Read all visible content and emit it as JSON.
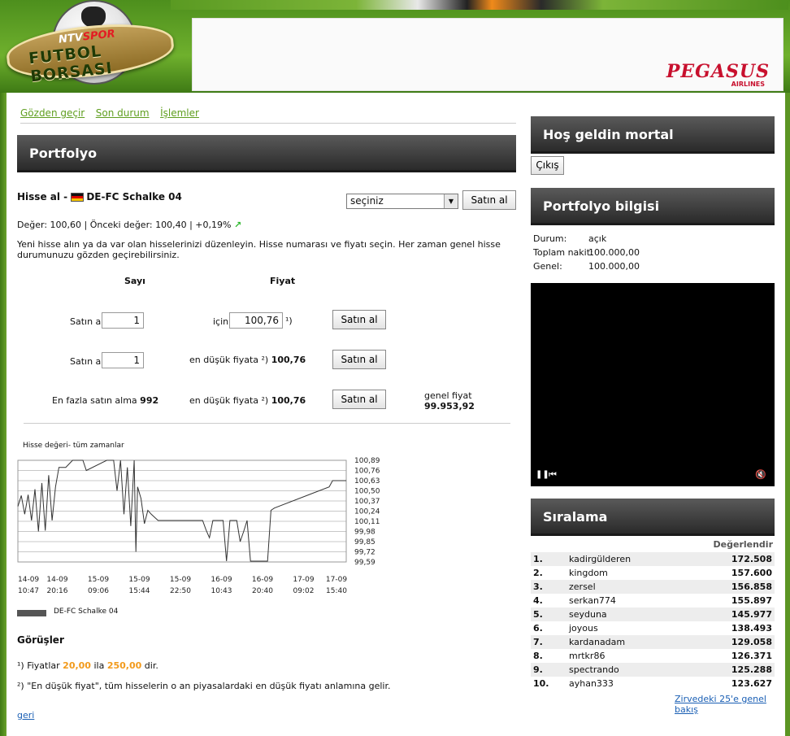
{
  "header": {
    "logo_ntv": "NTV",
    "logo_spor": "SPOR",
    "logo_title": "FUTBOL BORSASI",
    "ad_brand": "PEGASUS",
    "ad_brand_sub": "AIRLINES"
  },
  "tabs": [
    "Gözden geçir",
    "Son durum",
    "İşlemler"
  ],
  "portfolio": {
    "title": "Portfolyo",
    "buy_prefix": "Hisse al -",
    "team": "DE-FC Schalke 04",
    "select_value": "seçiniz",
    "select_button": "Satın al",
    "value_line": "Değer: 100,60 | Önceki değer: 100,40 | +0,19%",
    "trend_icon": "↗",
    "description": "Yeni hisse alın ya da var olan hisselerinizi düzenleyin. Hisse numarası ve fiyatı seçin. Her zaman genel hisse durumunuzu gözden geçirebilirsiniz.",
    "col_count": "Sayı",
    "col_price": "Fiyat",
    "row1": {
      "label": "Satın al",
      "qty": "1",
      "for": "için",
      "price": "100,76",
      "sup": "¹)",
      "button": "Satın al"
    },
    "row2": {
      "label": "Satın al",
      "qty": "1",
      "lowest_label": "en düşük fiyata ²)",
      "lowest_value": "100,76",
      "button": "Satın al"
    },
    "row3": {
      "label": "En fazla satın alma",
      "max": "992",
      "lowest_label": "en düşük fiyata ²)",
      "lowest_value": "100,76",
      "button": "Satın al",
      "total_label": "genel fiyat",
      "total_value": "99.953,92"
    }
  },
  "chart_data": {
    "type": "line",
    "title": "Hisse değeri- tüm zamanlar",
    "x_ticks": [
      "14-09\n10:47",
      "14-09\n20:16",
      "15-09\n09:06",
      "15-09\n15:44",
      "15-09\n22:50",
      "16-09\n10:43",
      "16-09\n20:40",
      "17-09\n09:02",
      "17-09\n15:40"
    ],
    "y_ticks": [
      "100,89",
      "100,76",
      "100,63",
      "100,50",
      "100,37",
      "100,24",
      "100,11",
      "99,98",
      "99,85",
      "99,72",
      "99,59"
    ],
    "ylim": [
      99.59,
      100.89
    ],
    "legend": "DE-FC Schalke 04",
    "series": [
      {
        "name": "DE-FC Schalke 04",
        "points": [
          [
            0,
            100.3
          ],
          [
            1,
            100.44
          ],
          [
            2,
            100.2
          ],
          [
            3,
            100.45
          ],
          [
            4,
            100.12
          ],
          [
            5,
            100.52
          ],
          [
            6,
            99.98
          ],
          [
            7,
            100.6
          ],
          [
            8,
            99.99
          ],
          [
            9,
            100.7
          ],
          [
            10,
            100.12
          ],
          [
            11,
            100.55
          ],
          [
            12,
            100.8
          ],
          [
            14,
            100.8
          ],
          [
            16,
            100.89
          ],
          [
            19,
            100.89
          ],
          [
            20,
            100.76
          ],
          [
            26,
            100.89
          ],
          [
            28,
            100.89
          ],
          [
            29,
            100.5
          ],
          [
            30,
            100.89
          ],
          [
            31,
            100.2
          ],
          [
            32,
            100.8
          ],
          [
            33,
            100.05
          ],
          [
            34,
            100.89
          ],
          [
            34.5,
            99.72
          ],
          [
            35,
            100.55
          ],
          [
            36,
            100.4
          ],
          [
            37,
            100.08
          ],
          [
            38,
            100.25
          ],
          [
            39,
            100.2
          ],
          [
            41,
            100.12
          ],
          [
            54,
            100.12
          ],
          [
            55,
            100.0
          ],
          [
            56,
            99.9
          ],
          [
            57,
            100.12
          ],
          [
            60,
            100.12
          ],
          [
            61,
            99.6
          ],
          [
            62,
            100.12
          ],
          [
            64,
            100.12
          ],
          [
            65,
            99.85
          ],
          [
            66,
            99.98
          ],
          [
            67,
            100.12
          ],
          [
            68,
            99.6
          ],
          [
            73,
            99.6
          ],
          [
            74,
            100.25
          ],
          [
            75,
            100.28
          ],
          [
            91,
            100.55
          ],
          [
            92,
            100.63
          ],
          [
            96,
            100.63
          ]
        ]
      }
    ]
  },
  "opinions": {
    "title": "Görüşler",
    "note1_pre": "¹) Fiyatlar",
    "note1_min": "20,00",
    "note1_mid": "ila",
    "note1_max": "250,00",
    "note1_post": "dir.",
    "note2": "²) \"En düşük fiyat\", tüm hisselerin o an piyasalardaki en düşük fiyatı anlamına gelir.",
    "back_link": "geri"
  },
  "sidebar": {
    "welcome": "Hoş geldin mortal",
    "logout": "Çıkış",
    "info_title": "Portfolyo bilgisi",
    "info": [
      {
        "k": "Durum:",
        "v": "açık"
      },
      {
        "k": "Toplam nakit:",
        "v": "100.000,00"
      },
      {
        "k": "Genel:",
        "v": "100.000,00"
      }
    ],
    "ranking_title": "Sıralama",
    "ranking_header": "Değerlendir",
    "ranking": [
      {
        "pos": "1.",
        "name": "kadirgülderen",
        "value": "172.508"
      },
      {
        "pos": "2.",
        "name": "kingdom",
        "value": "157.600"
      },
      {
        "pos": "3.",
        "name": "zersel",
        "value": "156.858"
      },
      {
        "pos": "4.",
        "name": "serkan774",
        "value": "155.897"
      },
      {
        "pos": "5.",
        "name": "seyduna",
        "value": "145.977"
      },
      {
        "pos": "6.",
        "name": "joyous",
        "value": "138.493"
      },
      {
        "pos": "7.",
        "name": "kardanadam",
        "value": "129.058"
      },
      {
        "pos": "8.",
        "name": "mrtkr86",
        "value": "126.371"
      },
      {
        "pos": "9.",
        "name": "spectrando",
        "value": "125.288"
      },
      {
        "pos": "10.",
        "name": "ayhan333",
        "value": "123.627"
      }
    ],
    "ranking_link": "Zirvedeki 25'e genel bakış"
  },
  "video": {
    "play_icon": "pause-icon",
    "back_icon": "skip-back-icon",
    "mute_icon": "mute-icon"
  }
}
